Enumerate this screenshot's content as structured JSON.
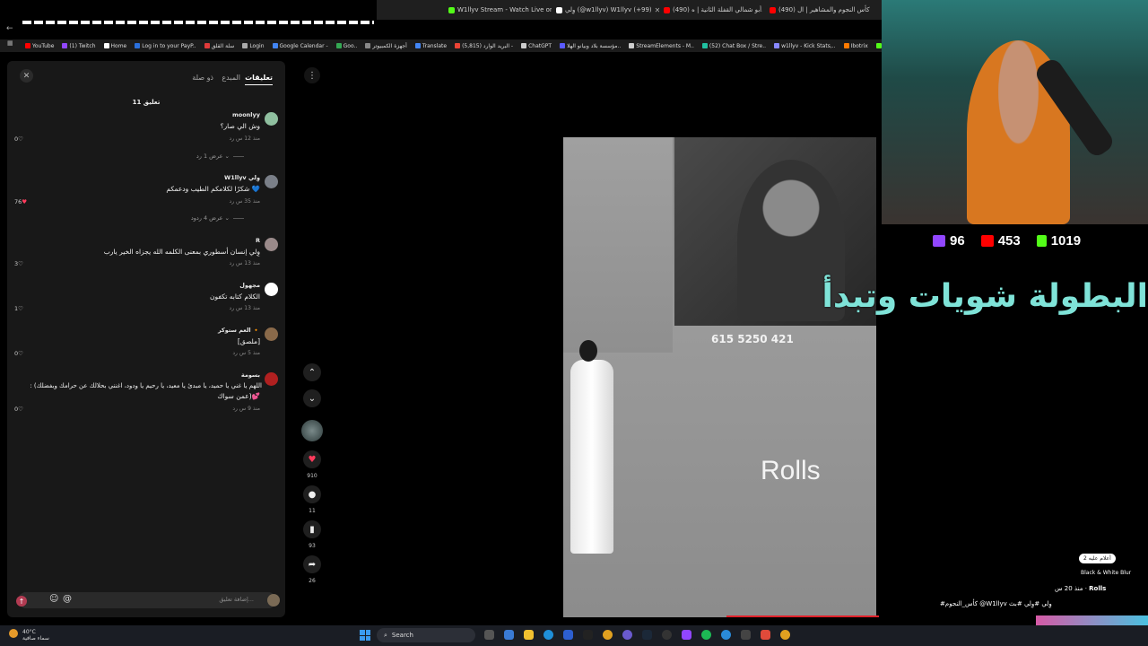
{
  "browser": {
    "tabs": [
      {
        "title": "W1llyv Stream - Watch Live on",
        "color": "#53fc18"
      },
      {
        "title": "وِلي (@w1llyv) W1llyv (+99)",
        "color": "#ffffff"
      },
      {
        "title": "(490) أبو شمالي القفلة الثانية | ه..",
        "color": "#ff0000"
      },
      {
        "title": "(490) كأس النجوم والمشاهير | ال",
        "color": "#ff0000"
      }
    ],
    "bookmarks": [
      {
        "label": "YouTube",
        "color": "#ff0000"
      },
      {
        "label": "(1) Twitch",
        "color": "#9146ff"
      },
      {
        "label": "Home",
        "color": "#ffffff"
      },
      {
        "label": "Log in to your PayP..",
        "color": "#2a6fdb"
      },
      {
        "label": "سلة القلق",
        "color": "#e03a3a"
      },
      {
        "label": "Login",
        "color": "#aaaaaa"
      },
      {
        "label": "Google Calendar -",
        "color": "#4285f4"
      },
      {
        "label": "Goo..",
        "color": "#34a853"
      },
      {
        "label": "أجهزة الكمبيوتر",
        "color": "#888888"
      },
      {
        "label": "Translate",
        "color": "#4285f4"
      },
      {
        "label": "(5,815) البريد الوارد -",
        "color": "#ea4335"
      },
      {
        "label": "ChatGPT",
        "color": "#cccccc"
      },
      {
        "label": "مؤسسة بلاد وبيانو الهلا..",
        "color": "#5a5aff"
      },
      {
        "label": "StreamElements - M..",
        "color": "#cccccc"
      },
      {
        "label": "(52) Chat Box / Stre..",
        "color": "#20c0a0"
      },
      {
        "label": "w1llyv - Kick Stats,..",
        "color": "#8888ff"
      },
      {
        "label": "Ibotrix",
        "color": "#ff7a00"
      },
      {
        "label": "Kick",
        "color": "#53fc18"
      }
    ]
  },
  "panel": {
    "tabs": {
      "comments": "تعليقات",
      "creator": "المبدع",
      "related": "ذو صلة"
    },
    "count": "11 تعليق",
    "input_placeholder": "إضافة تعليق...",
    "comments": [
      {
        "name": "moonlyy",
        "text": "وش الي صار؟",
        "meta": "منذ 12 س   رد",
        "likes": "0♡",
        "avatar": "#8fbf9f",
        "replies": "عرض 1 رد ⌄"
      },
      {
        "name": "W1llyv وِلي",
        "text": "شكرًا لكلامكم الطيب ودعمكم 💙",
        "meta": "منذ 35 س   رد",
        "likes": "76",
        "avatar": "#7a7f88",
        "replies": "عرض 4 ردود ⌄"
      },
      {
        "name": "R",
        "text": "وِلي إنسان أسطوري بمعنى الكلمه الله يجزاه الخير يارب",
        "meta": "منذ 13 س   رد",
        "likes": "3♡",
        "avatar": "#9a8a8a",
        "replies": ""
      },
      {
        "name": "مجهول",
        "text": "الكلام كتابه تكفون",
        "meta": "منذ 13 س   رد",
        "likes": "1♡",
        "avatar": "#ffffff",
        "replies": ""
      },
      {
        "name": "العم ستوكر 🔸",
        "text": "[ملصق]",
        "meta": "منذ 5 س   رد",
        "likes": "0♡",
        "avatar": "#8a6a4a",
        "replies": ""
      },
      {
        "name": "بسومة",
        "text": ": (اللهم يا غني يا حميد، يا مبدئ يا معيد، يا رحيم يا ودود، اغنني بحلالك عن حرامك وبفضلك",
        "text2": "عمن سواك)💕",
        "meta": "منذ 9 س   رد",
        "likes": "0♡",
        "avatar": "#b02020",
        "replies": ""
      }
    ]
  },
  "rail": {
    "likes": "910",
    "comments": "11",
    "saves": "93",
    "shares": "26"
  },
  "video": {
    "inner_stats": "615   5250   421",
    "watermark": "Rolls"
  },
  "stream": {
    "twitch_viewers": "96",
    "youtube_viewers": "453",
    "kick_viewers": "1019",
    "caption": "البطولة شويات وتبدأ",
    "chat_pill": "أعلام عليه 2",
    "song": "Black & White Blur",
    "chat_user": "Rolls",
    "chat_meta": "منذ 20 س",
    "chat_msg": "#كأس_النجوم @W1llyv وِلي #وِلي #بث"
  },
  "taskbar": {
    "temperature": "40°C",
    "weather_text": "سماء صافية",
    "search_label": "Search"
  }
}
